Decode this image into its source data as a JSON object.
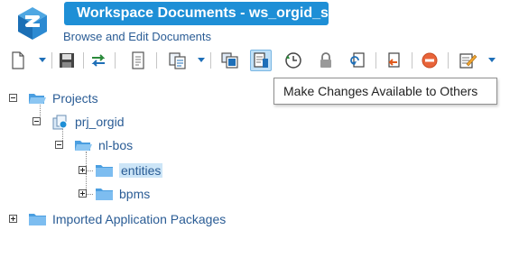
{
  "header": {
    "title": "Workspace Documents - ws_orgid_svn",
    "subtitle": "Browse and Edit Documents",
    "brand_color": "#1e8fd6"
  },
  "toolbar": {
    "buttons": [
      {
        "icon": "new-document-icon"
      },
      {
        "icon": "save-icon"
      },
      {
        "icon": "synchronize-icon"
      },
      {
        "icon": "document-icon"
      },
      {
        "icon": "copy-icon"
      },
      {
        "icon": "workspace-icon"
      },
      {
        "icon": "make-changes-available-icon",
        "active": true
      },
      {
        "icon": "history-icon"
      },
      {
        "icon": "lock-icon"
      },
      {
        "icon": "update-icon"
      },
      {
        "icon": "revert-icon"
      },
      {
        "icon": "stop-icon"
      },
      {
        "icon": "edit-icon"
      }
    ]
  },
  "tooltip": {
    "text": "Make Changes Available to Others"
  },
  "tree": {
    "projects": "Projects",
    "project": "prj_orgid",
    "folder": "nl-bos",
    "entities": "entities",
    "bpms": "bpms",
    "imported": "Imported Application Packages"
  }
}
